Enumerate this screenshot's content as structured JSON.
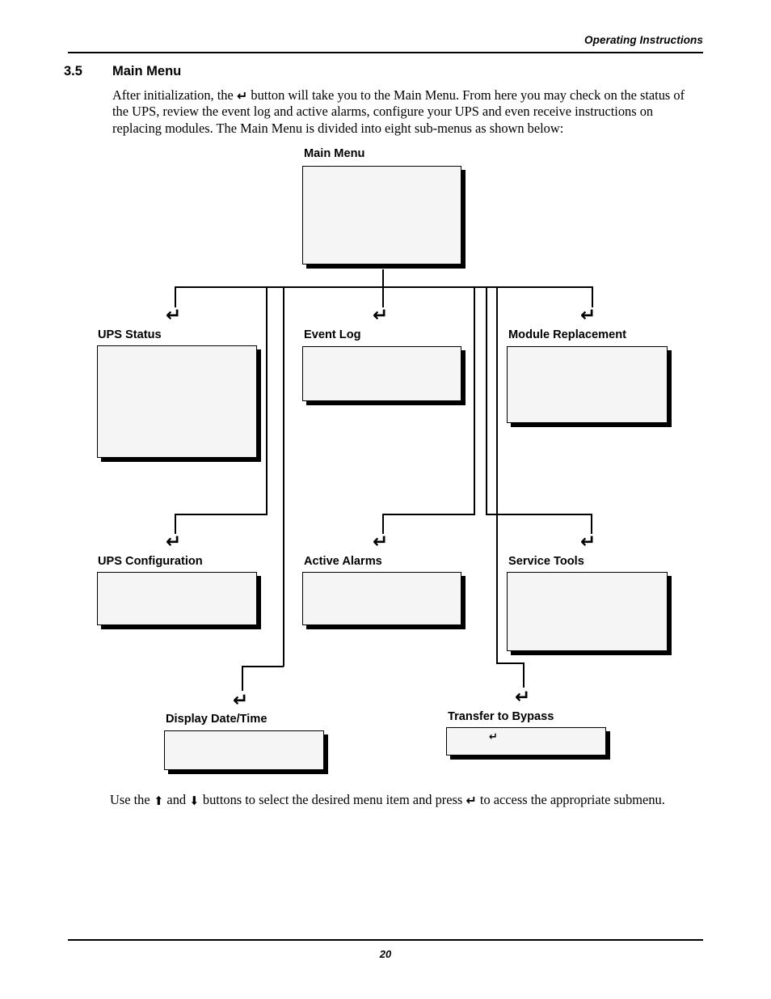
{
  "header": {
    "running_head": "Operating Instructions"
  },
  "section": {
    "number": "3.5",
    "title": "Main Menu"
  },
  "body": {
    "intro_part1": "After initialization, the",
    "intro_enter_icon": "enter-arrow-icon",
    "intro_part2": "button will take you to the Main Menu. From here you may check on the status of the UPS, review the event log and active alarms, configure your UPS and even receive instructions on replacing modules. The Main Menu is divided into eight sub-menus as shown below:",
    "outro_part1": "Use the",
    "outro_up_icon": "arrow-up-icon",
    "outro_part2": "and",
    "outro_down_icon": "arrow-down-icon",
    "outro_part3": "buttons to select the desired menu item and press",
    "outro_enter_icon": "enter-arrow-icon",
    "outro_part4": "to access the appropriate submenu."
  },
  "diagram": {
    "root": {
      "caption": "Main Menu",
      "screen_content": ""
    },
    "nodes": [
      {
        "caption": "UPS Status",
        "enter_glyph": "↵",
        "screen_content": ""
      },
      {
        "caption": "Event Log",
        "enter_glyph": "↵",
        "screen_content": ""
      },
      {
        "caption": "Module Replacement",
        "enter_glyph": "↵",
        "screen_content": ""
      },
      {
        "caption": "UPS Configuration",
        "enter_glyph": "↵",
        "screen_content": ""
      },
      {
        "caption": "Active Alarms",
        "enter_glyph": "↵",
        "screen_content": ""
      },
      {
        "caption": "Service Tools",
        "enter_glyph": "↵",
        "screen_content": ""
      },
      {
        "caption": "Display Date/Time",
        "enter_glyph": "↵",
        "screen_content": ""
      },
      {
        "caption": "Transfer to Bypass",
        "enter_glyph": "↵",
        "screen_content": "↵"
      }
    ],
    "submenu_count_text": "eight"
  },
  "footer": {
    "page_number": "20"
  },
  "glyphs": {
    "enter": "↵",
    "arrow_up": "⬆",
    "arrow_down": "⬇"
  },
  "colors": {
    "ink": "#000000",
    "page": "#ffffff",
    "screen_face": "#f5f5f5"
  }
}
